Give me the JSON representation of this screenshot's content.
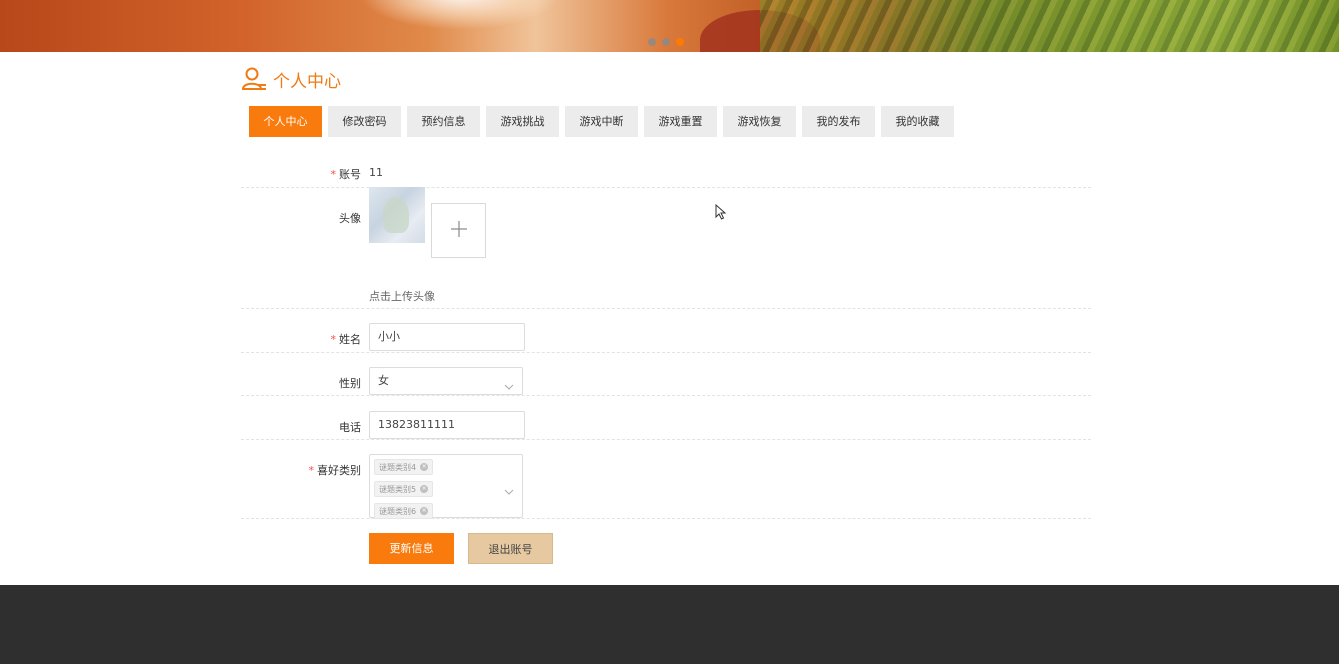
{
  "banner": {
    "active_slide": 3,
    "slide_count": 3
  },
  "page": {
    "title": "个人中心"
  },
  "tabs": [
    {
      "label": "个人中心",
      "active": true
    },
    {
      "label": "修改密码"
    },
    {
      "label": "预约信息"
    },
    {
      "label": "游戏挑战"
    },
    {
      "label": "游戏中断"
    },
    {
      "label": "游戏重置"
    },
    {
      "label": "游戏恢复"
    },
    {
      "label": "我的发布"
    },
    {
      "label": "我的收藏"
    }
  ],
  "form": {
    "account": {
      "label": "账号",
      "required": "*",
      "value": "11"
    },
    "avatar": {
      "label": "头像",
      "upload_hint": "点击上传头像"
    },
    "name": {
      "label": "姓名",
      "required": "*",
      "value": "小小"
    },
    "gender": {
      "label": "性别",
      "value": "女"
    },
    "phone": {
      "label": "电话",
      "value": "13823811111"
    },
    "preference": {
      "label": "喜好类别",
      "required": "*",
      "tags": [
        "谜题类别4",
        "谜题类别5",
        "谜题类别6"
      ]
    }
  },
  "buttons": {
    "update": "更新信息",
    "logout": "退出账号"
  },
  "colors": {
    "accent": "#f97b0d",
    "title": "#f07a13",
    "secondary_btn": "#e6c9a0",
    "footer": "#2f2f2f"
  }
}
